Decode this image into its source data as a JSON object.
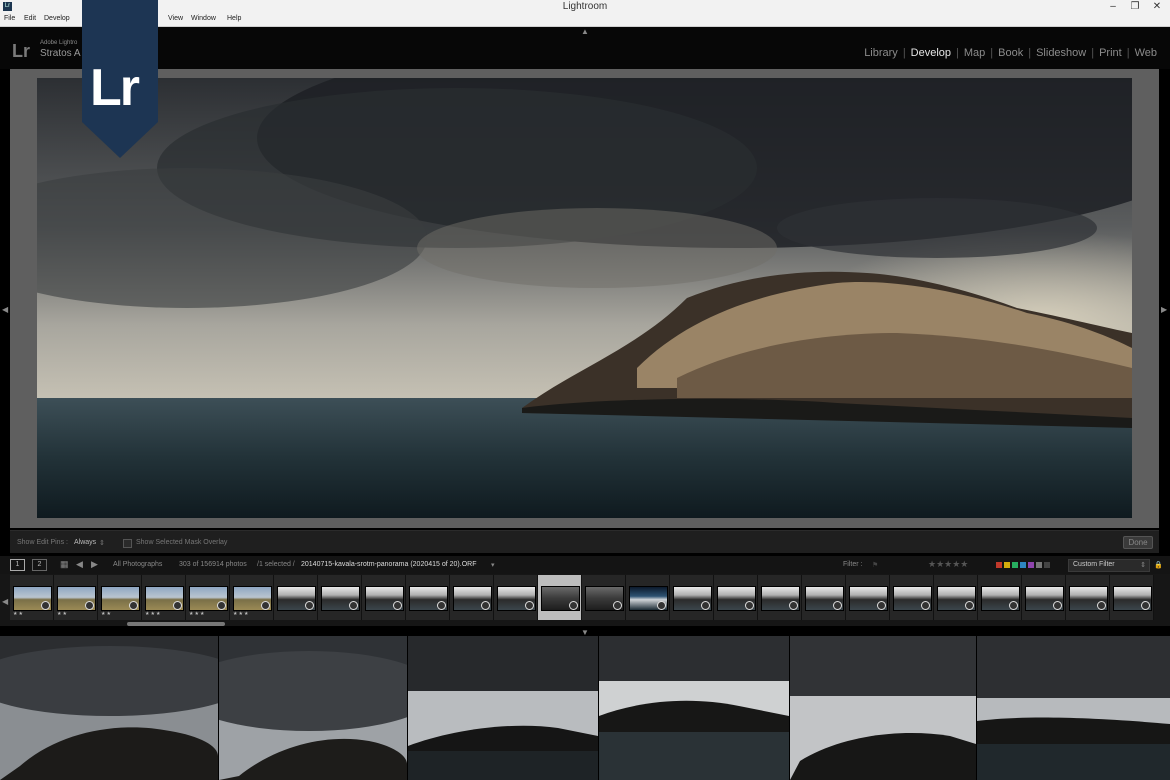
{
  "window": {
    "title": "Lightroom",
    "controls": [
      "–",
      "❐",
      "✕"
    ]
  },
  "menus": [
    "File",
    "Edit",
    "Develop",
    "View",
    "Window",
    "Help"
  ],
  "identity": {
    "app_small": "Adobe Lightro",
    "user": "Stratos A",
    "mark": "Lr",
    "badge_text": "Lr"
  },
  "modules": [
    "Library",
    "Develop",
    "Map",
    "Book",
    "Slideshow",
    "Print",
    "Web"
  ],
  "active_module": "Develop",
  "toolbar": {
    "edit_pins_label": "Show Edit Pins :",
    "edit_pins_value": "Always",
    "mask_overlay_label": "Show Selected Mask Overlay",
    "done_label": "Done"
  },
  "filmstrip_bar": {
    "view1": "1",
    "view2": "2",
    "source": "All Photographs",
    "info_count": "303 of 156914 photos",
    "info_selected": "/1 selected /",
    "info_filename": "20140715-kavala-srotm-panorama (2020415 of 20).ORF",
    "filter_label": "Filter :",
    "filter_stars": "★★★★★",
    "custom_filter": "Custom Filter"
  },
  "colors": {
    "active_module": "#e6e6e6",
    "inactive_module": "#8c8c8c",
    "badge_navy": "#1d3553",
    "viewer_bg": "#5f5f5f",
    "selected_cell": "#bdbdbd"
  },
  "icons": {
    "grid": "grid-view-icon",
    "back": "arrow-left-icon",
    "forward": "arrow-right-icon",
    "dropdown": "chevron-down-icon",
    "flag": "flag-icon",
    "lock": "lock-icon"
  },
  "thumbnails": [
    {
      "style": "landscape",
      "stars": "★★"
    },
    {
      "style": "landscape",
      "stars": "★★"
    },
    {
      "style": "landscape",
      "stars": "★★"
    },
    {
      "style": "landscape",
      "stars": "★★★"
    },
    {
      "style": "landscape",
      "stars": "★★★"
    },
    {
      "style": "landscape",
      "stars": "★★★"
    },
    {
      "style": "sea",
      "stars": ""
    },
    {
      "style": "sea",
      "stars": ""
    },
    {
      "style": "sea",
      "stars": ""
    },
    {
      "style": "sea",
      "stars": ""
    },
    {
      "style": "sea",
      "stars": ""
    },
    {
      "style": "sea",
      "stars": ""
    },
    {
      "style": "pano",
      "stars": ""
    },
    {
      "style": "pano",
      "stars": ""
    },
    {
      "style": "blue",
      "stars": ""
    },
    {
      "style": "sea",
      "stars": ""
    },
    {
      "style": "sea",
      "stars": ""
    },
    {
      "style": "sea",
      "stars": ""
    },
    {
      "style": "sea",
      "stars": ""
    },
    {
      "style": "sea",
      "stars": ""
    },
    {
      "style": "sea",
      "stars": ""
    },
    {
      "style": "sea",
      "stars": ""
    },
    {
      "style": "sea",
      "stars": ""
    },
    {
      "style": "sea",
      "stars": ""
    },
    {
      "style": "sea",
      "stars": ""
    },
    {
      "style": "sea",
      "stars": ""
    }
  ],
  "selected_thumbnail": 12
}
